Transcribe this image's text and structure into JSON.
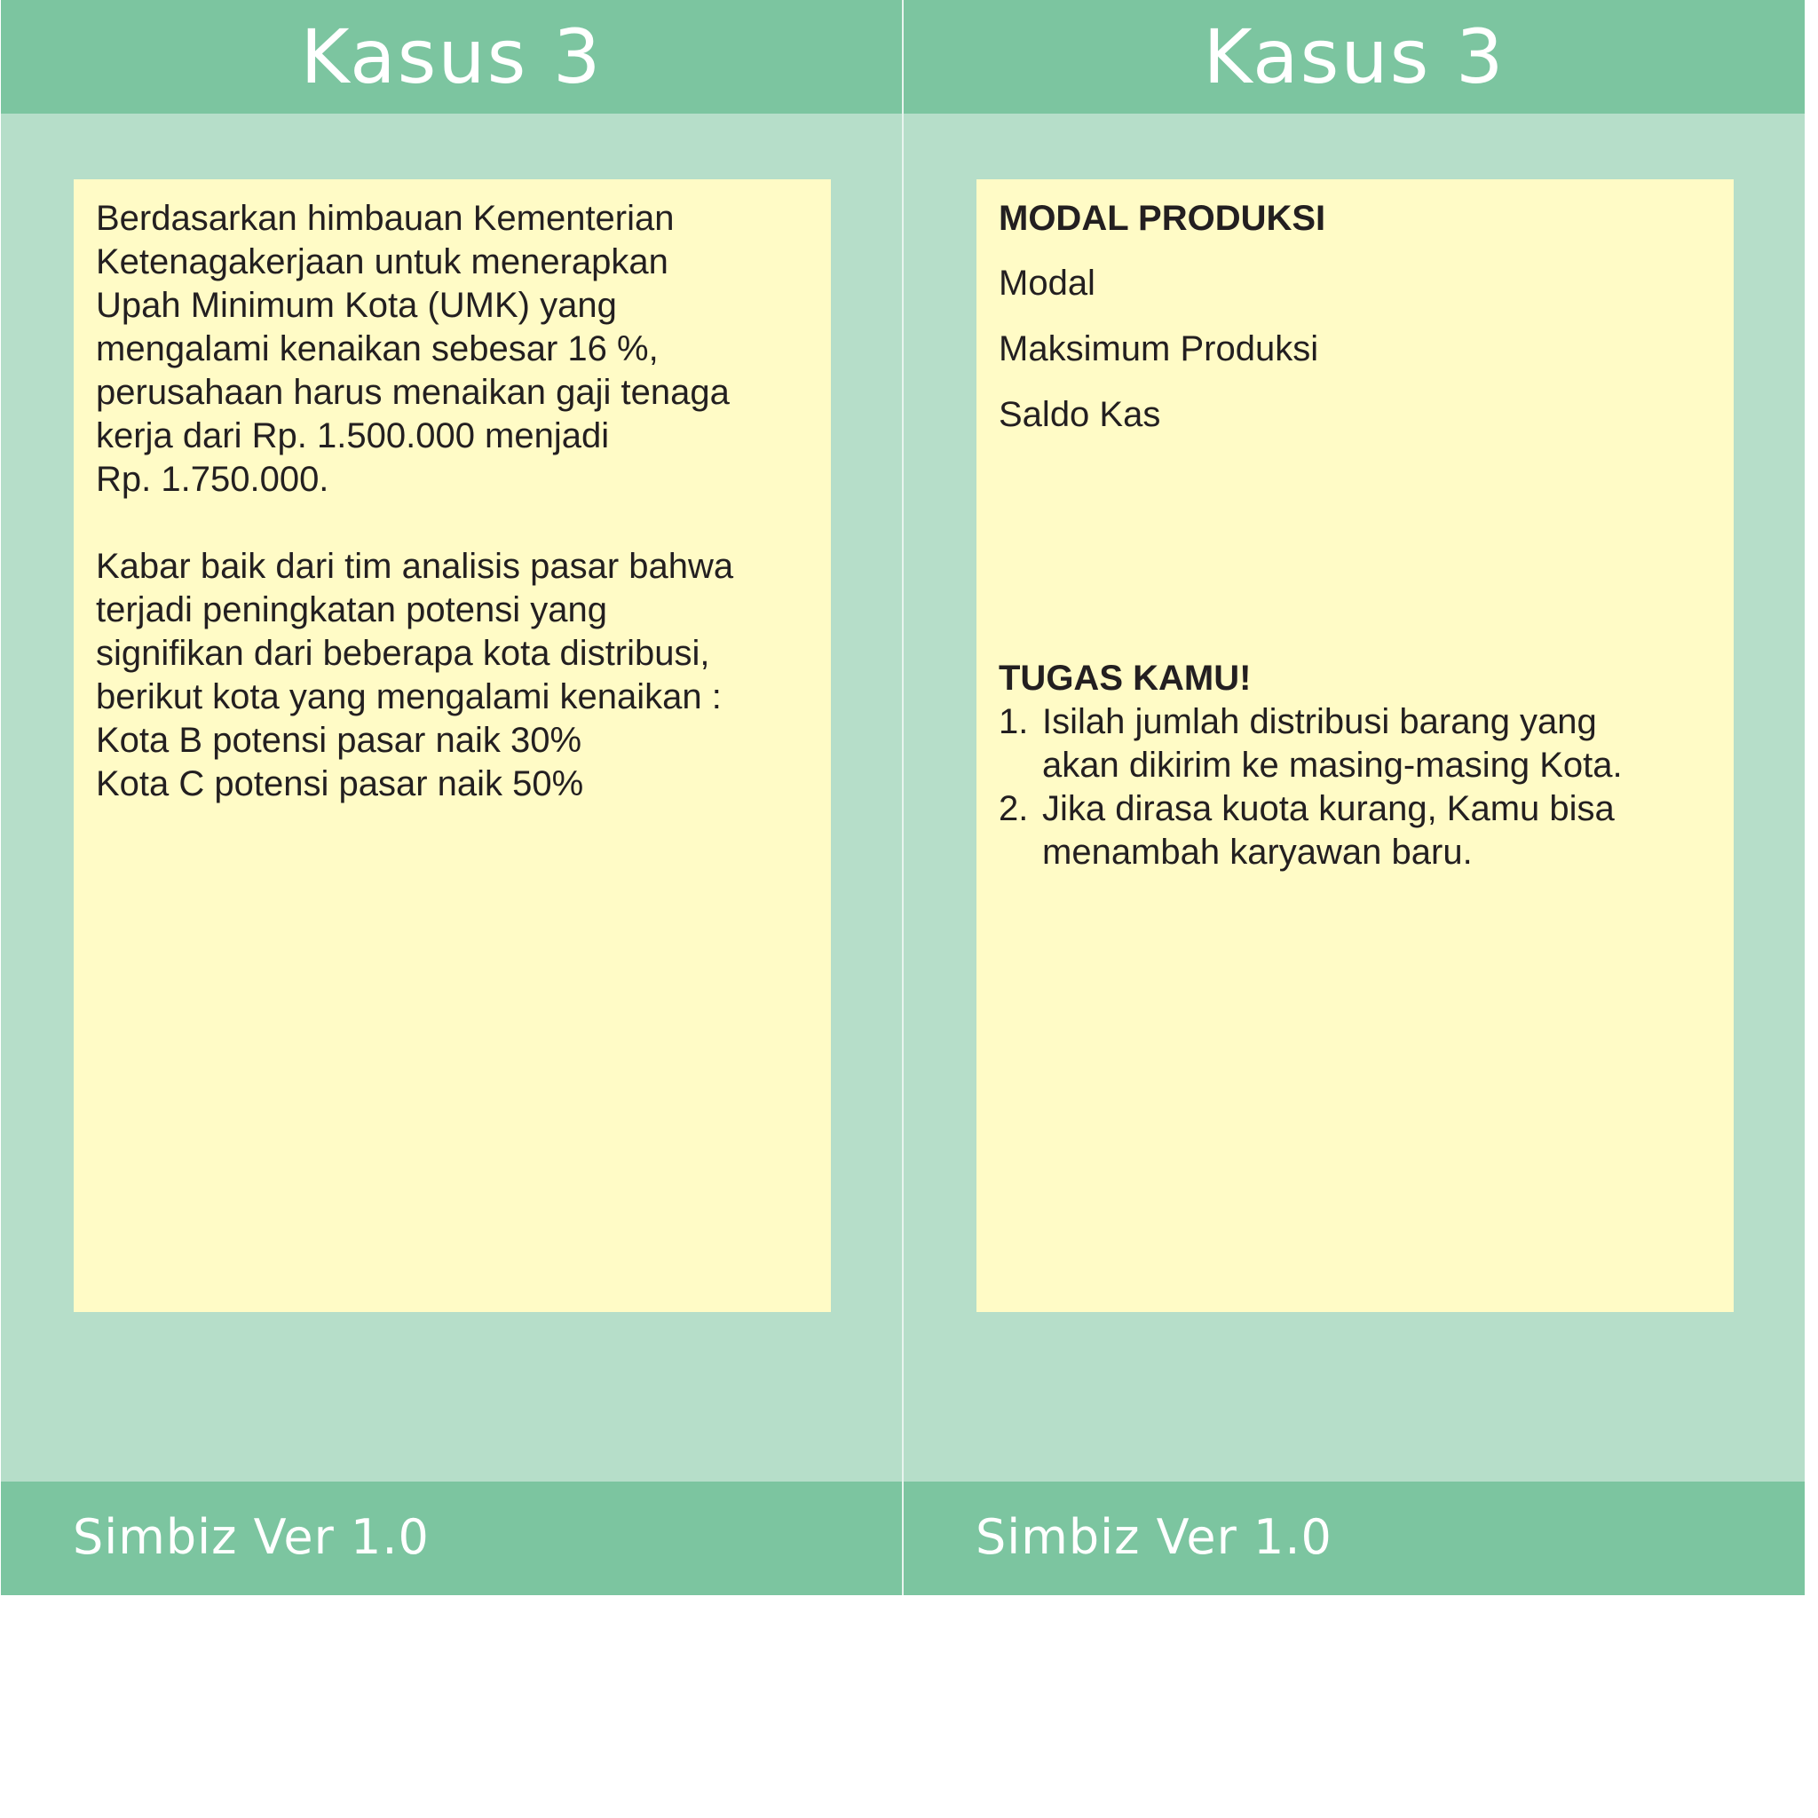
{
  "left_card": {
    "title": "Kasus 3",
    "paragraph1": "Berdasarkan himbauan Kementerian\nKetenagakerjaan untuk menerapkan\nUpah Minimum Kota (UMK) yang\nmengalami kenaikan sebesar 16 %,\nperusahaan harus menaikan gaji tenaga\nkerja dari Rp. 1.500.000 menjadi\nRp. 1.750.000.",
    "paragraph2": "Kabar baik dari tim analisis pasar bahwa\nterjadi peningkatan  potensi yang\nsignifikan dari beberapa kota distribusi,\nberikut kota yang mengalami kenaikan :\nKota B potensi pasar naik 30%\nKota C potensi pasar naik 50%",
    "footer": "Simbiz Ver 1.0"
  },
  "right_card": {
    "title": "Kasus 3",
    "modal_heading": "MODAL PRODUKSI",
    "modal_items": [
      "Modal",
      "Maksimum Produksi",
      "Saldo Kas"
    ],
    "tasks_heading": "TUGAS KAMU!",
    "tasks": [
      {
        "num": "1.",
        "text": "Isilah jumlah distribusi barang yang\nakan dikirim ke masing-masing Kota."
      },
      {
        "num": "2.",
        "text": "Jika dirasa kuota kurang, Kamu bisa\nmenambah karyawan baru."
      }
    ],
    "footer": "Simbiz Ver 1.0"
  },
  "colors": {
    "header_footer_bar": "#7cc5a0",
    "card_background": "#b6dec9",
    "note_background": "#fffbc6",
    "text": "#231f20"
  }
}
